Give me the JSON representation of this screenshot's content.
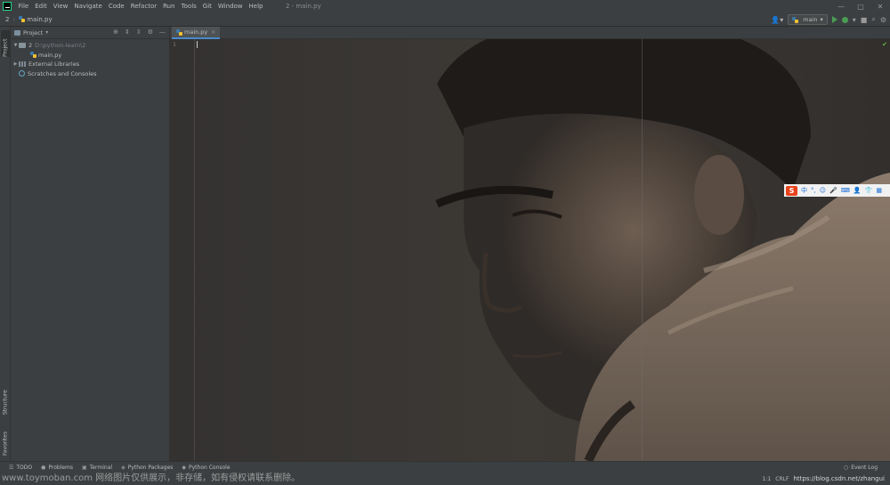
{
  "menubar": {
    "items": [
      "File",
      "Edit",
      "View",
      "Navigate",
      "Code",
      "Refactor",
      "Run",
      "Tools",
      "Git",
      "Window",
      "Help"
    ],
    "window_title": "2 - main.py"
  },
  "navbar": {
    "project": "2",
    "file": "main.py",
    "run_config": "main"
  },
  "left_strip": {
    "project_tab": "Project",
    "structure_tab": "Structure",
    "favorites_tab": "Favorites"
  },
  "project_pane": {
    "title": "Project",
    "tree": {
      "root_name": "2",
      "root_path": "D:\\python-learn\\2",
      "file": "main.py",
      "external_libraries": "External Libraries",
      "scratches": "Scratches and Consoles"
    }
  },
  "editor": {
    "tab_label": "main.py",
    "line_number": "1"
  },
  "ime_bar": {
    "logo": "S",
    "items": [
      "中",
      "°,",
      "☺",
      "🎤",
      "⌨",
      "👤",
      "👕",
      "▦"
    ]
  },
  "bottom_tools": {
    "todo": "TODO",
    "problems": "Problems",
    "terminal": "Terminal",
    "python_packages": "Python Packages",
    "python_console": "Python Console",
    "event_log": "Event Log"
  },
  "status_bar": {
    "watermark": "www.toymoban.com 网络图片仅供展示，非存储，如有侵权请联系删除。",
    "position": "1:1",
    "line_sep": "CRLF",
    "csdn": "https://blog.csdn.net/zhangui"
  },
  "colors": {
    "accent_blue": "#4a88c7",
    "run_green": "#499c54",
    "ime_red": "#e8421c"
  }
}
